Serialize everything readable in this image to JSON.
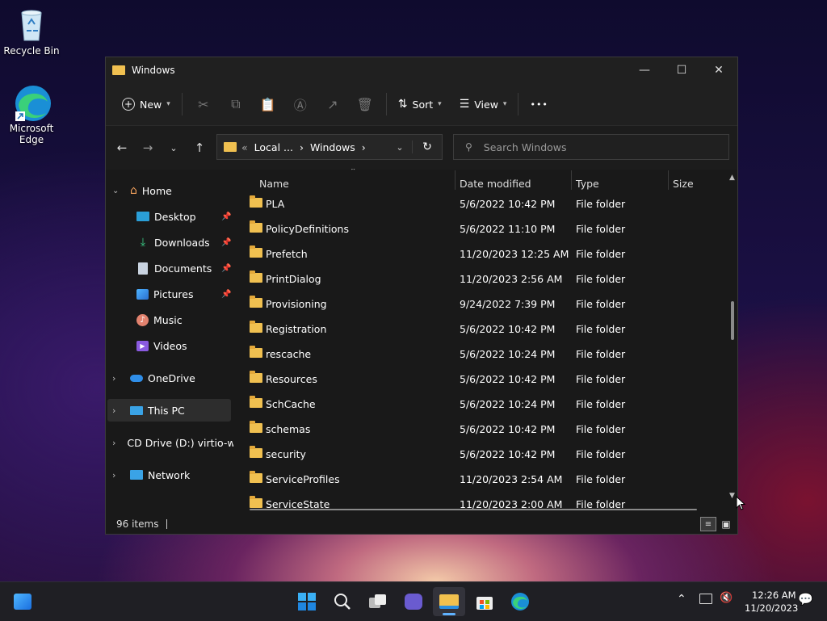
{
  "desktop": {
    "recycle_bin": "Recycle Bin",
    "edge_line1": "Microsoft",
    "edge_line2": "Edge"
  },
  "window": {
    "title": "Windows",
    "controls": {
      "minimize": "—",
      "maximize": "☐",
      "close": "✕"
    }
  },
  "toolbar": {
    "new_label": "New",
    "sort_label": "Sort",
    "view_label": "View",
    "more": "•••"
  },
  "address": {
    "prefix": "«",
    "segment1": "Local ...",
    "separator": "›",
    "segment2": "Windows"
  },
  "search": {
    "placeholder": "Search Windows"
  },
  "sidebar": {
    "items": [
      {
        "label": "Home"
      },
      {
        "label": "Desktop"
      },
      {
        "label": "Downloads"
      },
      {
        "label": "Documents"
      },
      {
        "label": "Pictures"
      },
      {
        "label": "Music"
      },
      {
        "label": "Videos"
      },
      {
        "label": "OneDrive"
      },
      {
        "label": "This PC"
      },
      {
        "label": "CD Drive (D:) virtio-w"
      },
      {
        "label": "Network"
      }
    ]
  },
  "columns": {
    "name": "Name",
    "date": "Date modified",
    "type": "Type",
    "size": "Size"
  },
  "files": [
    {
      "name": "PLA",
      "date": "5/6/2022 10:42 PM",
      "type": "File folder"
    },
    {
      "name": "PolicyDefinitions",
      "date": "5/6/2022 11:10 PM",
      "type": "File folder"
    },
    {
      "name": "Prefetch",
      "date": "11/20/2023 12:25 AM",
      "type": "File folder"
    },
    {
      "name": "PrintDialog",
      "date": "11/20/2023 2:56 AM",
      "type": "File folder"
    },
    {
      "name": "Provisioning",
      "date": "9/24/2022 7:39 PM",
      "type": "File folder"
    },
    {
      "name": "Registration",
      "date": "5/6/2022 10:42 PM",
      "type": "File folder"
    },
    {
      "name": "rescache",
      "date": "5/6/2022 10:24 PM",
      "type": "File folder"
    },
    {
      "name": "Resources",
      "date": "5/6/2022 10:42 PM",
      "type": "File folder"
    },
    {
      "name": "SchCache",
      "date": "5/6/2022 10:24 PM",
      "type": "File folder"
    },
    {
      "name": "schemas",
      "date": "5/6/2022 10:42 PM",
      "type": "File folder"
    },
    {
      "name": "security",
      "date": "5/6/2022 10:42 PM",
      "type": "File folder"
    },
    {
      "name": "ServiceProfiles",
      "date": "11/20/2023 2:54 AM",
      "type": "File folder"
    },
    {
      "name": "ServiceState",
      "date": "11/20/2023 2:00 AM",
      "type": "File folder"
    }
  ],
  "status": {
    "count": "96 items"
  },
  "taskbar": {
    "time": "12:26 AM",
    "date": "11/20/2023"
  }
}
